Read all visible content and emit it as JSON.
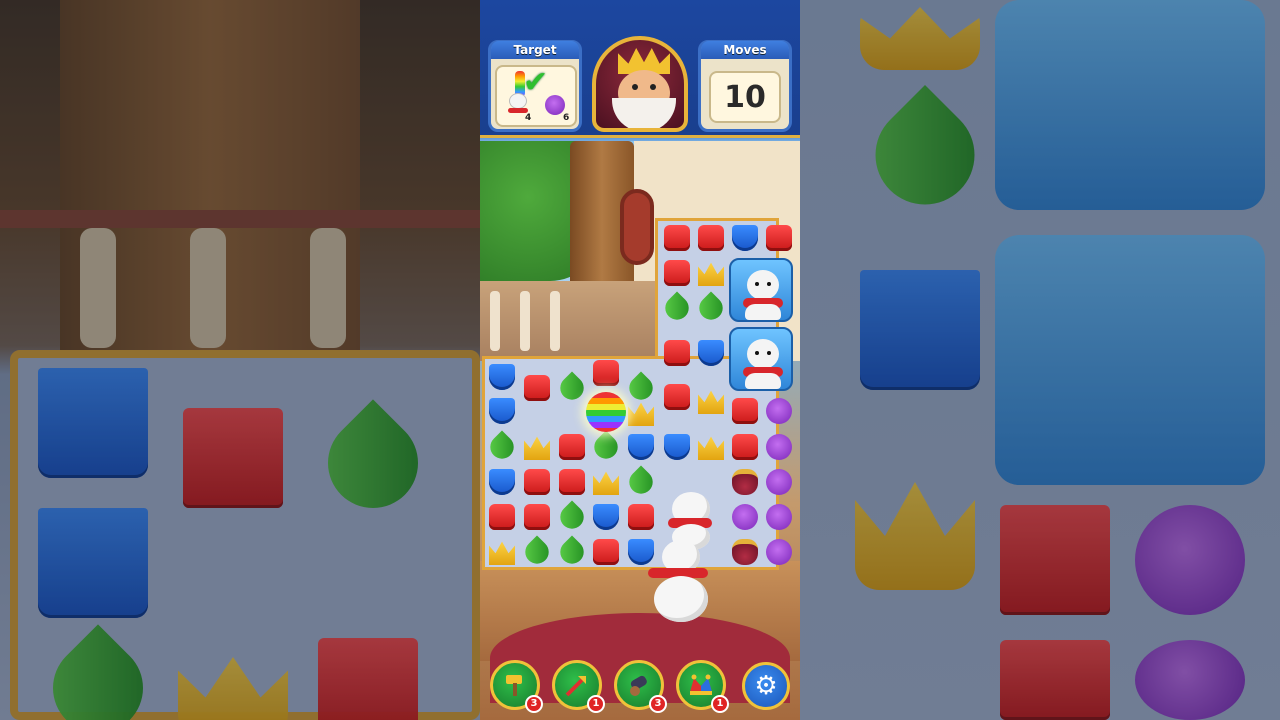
{
  "hud": {
    "target_label": "Target",
    "moves_label": "Moves",
    "moves_value": "10",
    "targets": [
      {
        "name": "polar-bear",
        "count": "4"
      },
      {
        "name": "purple-pig",
        "count": "6"
      }
    ],
    "target_complete_icon": "checkmark-icon"
  },
  "avatar": {
    "name": "king-avatar"
  },
  "board": {
    "piece_colors": {
      "red": "#e52424",
      "blue": "#2a6fe0",
      "green": "#2fa82f",
      "yellow": "#f2b81e",
      "purple": "#9b3fd6",
      "pot": "#8a1a30"
    }
  },
  "boosters": [
    {
      "icon": "hammer-icon",
      "count": "3"
    },
    {
      "icon": "arrow-icon",
      "count": "1"
    },
    {
      "icon": "cannon-icon",
      "count": "3"
    },
    {
      "icon": "jester-hat-icon",
      "count": "1"
    }
  ],
  "settings": {
    "icon": "gear-icon"
  }
}
